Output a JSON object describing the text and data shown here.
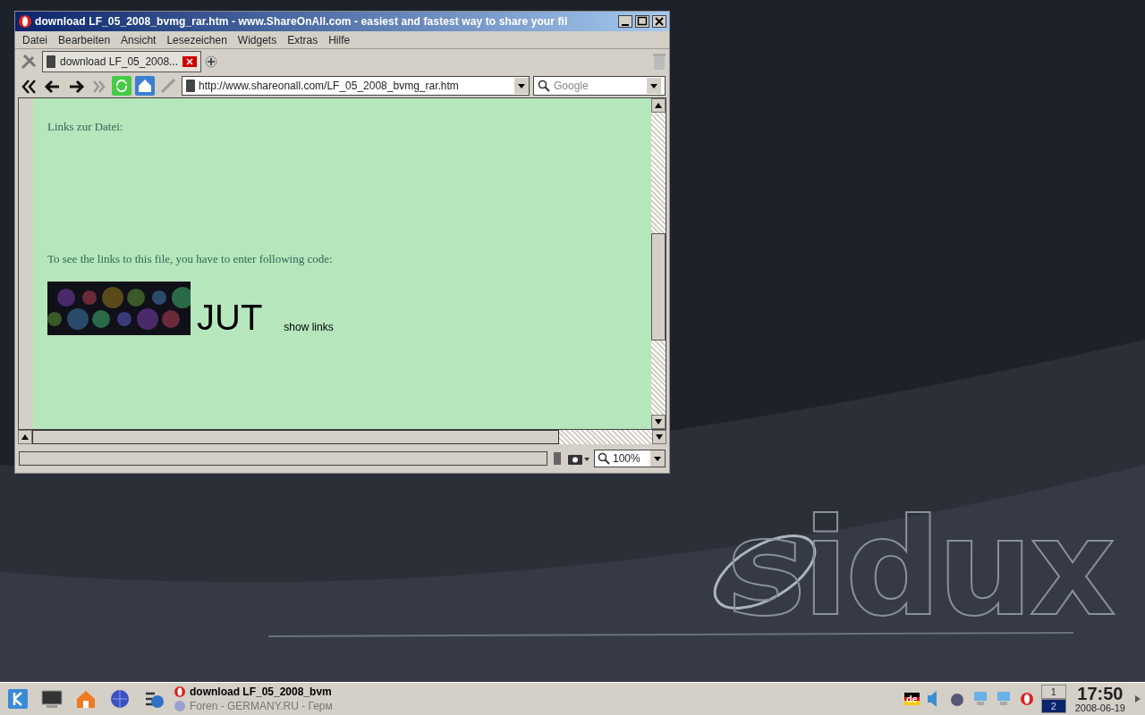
{
  "window": {
    "title": "download LF_05_2008_bvmg_rar.htm - www.ShareOnAll.com - easiest and fastest way to share your fil"
  },
  "menu": [
    "Datei",
    "Bearbeiten",
    "Ansicht",
    "Lesezeichen",
    "Widgets",
    "Extras",
    "Hilfe"
  ],
  "tabs": [
    {
      "label": "download LF_05_2008...",
      "selected": true
    }
  ],
  "address": {
    "value": "http://www.shareonall.com/LF_05_2008_bvmg_rar.htm"
  },
  "search": {
    "placeholder": "Google"
  },
  "page": {
    "links_label": "Links zur Datei:",
    "instruction": "To see the links to this file, you have to enter following code:",
    "code": "JUT",
    "button": "show links"
  },
  "status_bar": {
    "zoom": "100%"
  },
  "wallpaper_logo": "sidux",
  "taskbar": {
    "tasks": [
      {
        "label": "download LF_05_2008_bvm",
        "selected": true
      },
      {
        "label": "Foren - GERMANY.RU - Герм",
        "selected": false
      }
    ],
    "pager": [
      {
        "label": "1",
        "selected": false
      },
      {
        "label": "2",
        "selected": true
      }
    ],
    "time": "17:50",
    "date": "2008-06-19",
    "keyboard": "de"
  }
}
